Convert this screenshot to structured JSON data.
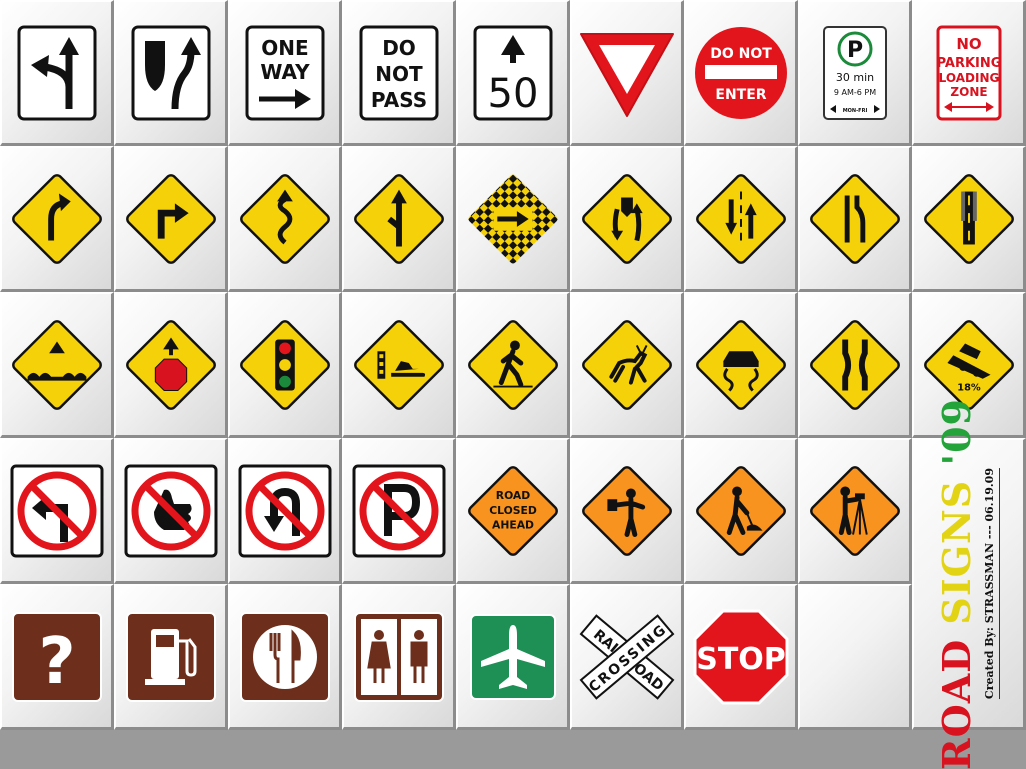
{
  "signs": {
    "one_way_top": "ONE",
    "one_way_bottom": "WAY",
    "do_not_1": "DO",
    "do_not_2": "NOT",
    "do_not_3": "PASS",
    "speed": "50",
    "dne_top": "DO NOT",
    "dne_bottom": "ENTER",
    "parking_letter": "P",
    "parking_time": "30 min",
    "parking_hours": "9 AM-6 PM",
    "parking_days": "MON-FRI",
    "np_1": "NO",
    "np_2": "PARKING",
    "np_3": "LOADING",
    "np_4": "ZONE",
    "grade": "18%",
    "rc_1": "ROAD",
    "rc_2": "CLOSED",
    "rc_3": "AHEAD",
    "question": "?",
    "rr_1": "RAIL",
    "rr_2": "ROAD",
    "rr_3": "CROSSING",
    "stop": "STOP"
  },
  "credit": {
    "title_road": "ROAD",
    "title_signs": "SIGNS",
    "title_year": "'09",
    "created_by": "Created By: STRASSMAN",
    "separator": "---",
    "date": "06.19.09"
  },
  "colors": {
    "warning_yellow": "#f5d10a",
    "work_orange": "#f7931e",
    "service_brown": "#6d2f1c",
    "airport_green": "#1e8f55",
    "stop_red": "#e3151c",
    "title_red": "#d8121e",
    "title_yellow": "#e3d315",
    "title_green": "#23a33a"
  }
}
